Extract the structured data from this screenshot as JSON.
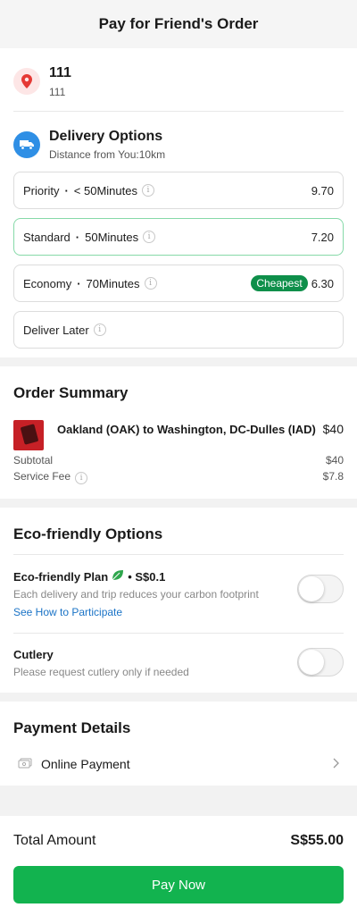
{
  "header": {
    "title": "Pay for Friend's Order"
  },
  "address": {
    "title": "111",
    "subtitle": "111",
    "icon": "location-pin-icon"
  },
  "delivery": {
    "title": "Delivery Options",
    "distance": "Distance from You:10km",
    "options": [
      {
        "name": "Priority",
        "time": "< 50Minutes",
        "price": "9.70",
        "badge": "",
        "selected": false
      },
      {
        "name": "Standard",
        "time": "50Minutes",
        "price": "7.20",
        "badge": "",
        "selected": true
      },
      {
        "name": "Economy",
        "time": "70Minutes",
        "price": "6.30",
        "badge": "Cheapest",
        "selected": false
      }
    ],
    "later": "Deliver Later"
  },
  "order_summary": {
    "title": "Order Summary",
    "item": {
      "name": "Oakland (OAK) to Washington, DC-Dulles (IAD)",
      "price": "$40"
    },
    "subtotal_label": "Subtotal",
    "subtotal": "$40",
    "service_fee_label": "Service Fee",
    "service_fee": "$7.8"
  },
  "eco": {
    "title": "Eco-friendly Options",
    "plan_title": "Eco-friendly Plan",
    "plan_price": "• S$0.1",
    "plan_desc": "Each delivery and trip reduces your carbon footprint",
    "plan_link": "See How to Participate",
    "plan_enabled": false,
    "cutlery_title": "Cutlery",
    "cutlery_desc": "Please request cutlery only if needed",
    "cutlery_enabled": false
  },
  "payment": {
    "title": "Payment Details",
    "method": "Online Payment"
  },
  "total": {
    "label": "Total Amount",
    "value": "S$55.00"
  },
  "pay_button": "Pay Now",
  "colors": {
    "accent": "#12b34f",
    "badge": "#0e8f4a",
    "link": "#1a73c6",
    "truck": "#2f8fe5"
  }
}
